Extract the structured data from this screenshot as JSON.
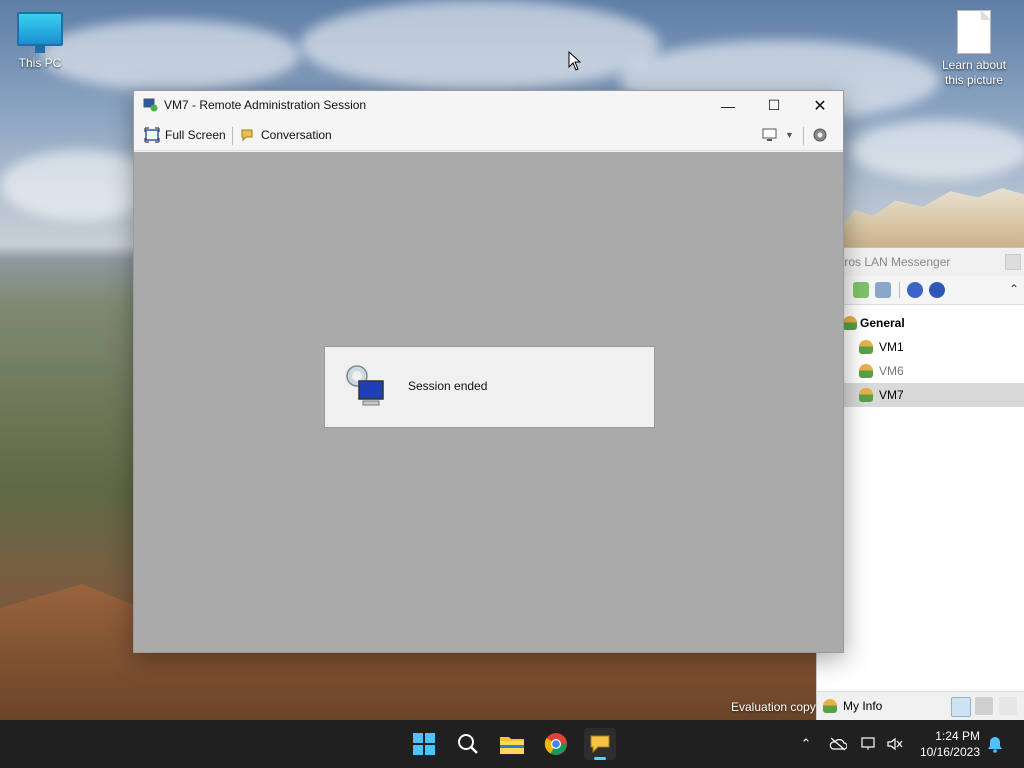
{
  "desktop": {
    "icons": [
      {
        "label": "This PC",
        "icon": "monitor-icon"
      },
      {
        "label": "Learn about\nthis picture",
        "icon": "file-icon"
      }
    ],
    "watermark": "Evaluation copy"
  },
  "messenger": {
    "title": "tros LAN Messenger",
    "group": "General",
    "users": [
      "VM1",
      "VM6",
      "VM7"
    ],
    "selected_user": "VM7",
    "my_info": "My Info"
  },
  "remote_window": {
    "title": "VM7 - Remote Administration Session",
    "toolbar": {
      "full_screen": "Full Screen",
      "conversation": "Conversation"
    },
    "dialog": {
      "message": "Session ended"
    }
  },
  "taskbar": {
    "apps": [
      "start-icon",
      "search-icon",
      "file-explorer-icon",
      "chrome-icon",
      "messenger-icon"
    ],
    "time": "1:24 PM",
    "date": "10/16/2023"
  },
  "colors": {
    "taskbar_bg": "#202020",
    "window_body": "#aaaaaa",
    "accent": "#60cdff"
  }
}
